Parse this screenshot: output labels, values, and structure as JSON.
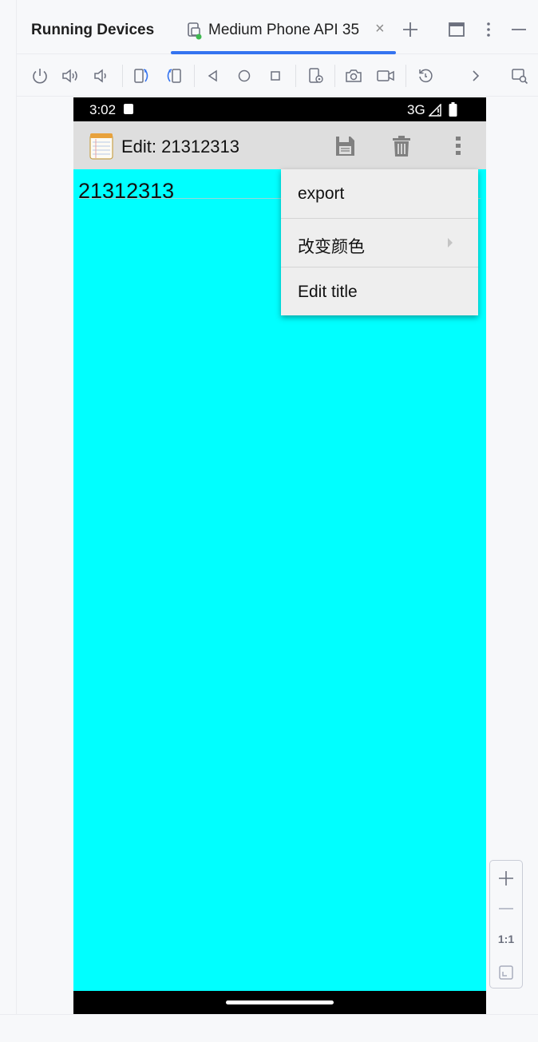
{
  "ide": {
    "panel_title": "Running Devices",
    "device_tab": {
      "label": "Medium Phone API 35",
      "close_glyph": "×",
      "status_color": "#3fb950"
    },
    "new_tab_glyph": "+",
    "accent_color": "#3574f0",
    "toolbar_icons": [
      "power-icon",
      "volume-up-icon",
      "volume-down-icon",
      "rotate-left-icon",
      "rotate-right-icon",
      "back-icon",
      "home-icon",
      "overview-icon",
      "device-settings-icon",
      "screenshot-icon",
      "screen-record-icon",
      "reset-icon",
      "more-chevron-icon",
      "device-explorer-icon"
    ],
    "zoom": {
      "plus": "+",
      "minus": "—",
      "actual_size": "1:1"
    }
  },
  "phone": {
    "status_bar": {
      "time": "3:02",
      "network": "3G"
    },
    "action_bar": {
      "title": "Edit: 21312313",
      "icons": [
        "save-icon",
        "delete-icon",
        "overflow-menu-icon"
      ]
    },
    "note": {
      "text": "21312313",
      "background_color": "#00ffff"
    },
    "overflow_menu": {
      "items": [
        {
          "label": "export",
          "has_submenu": false
        },
        {
          "label": "改变颜色",
          "has_submenu": true
        },
        {
          "label": "Edit title",
          "has_submenu": false
        }
      ]
    }
  }
}
